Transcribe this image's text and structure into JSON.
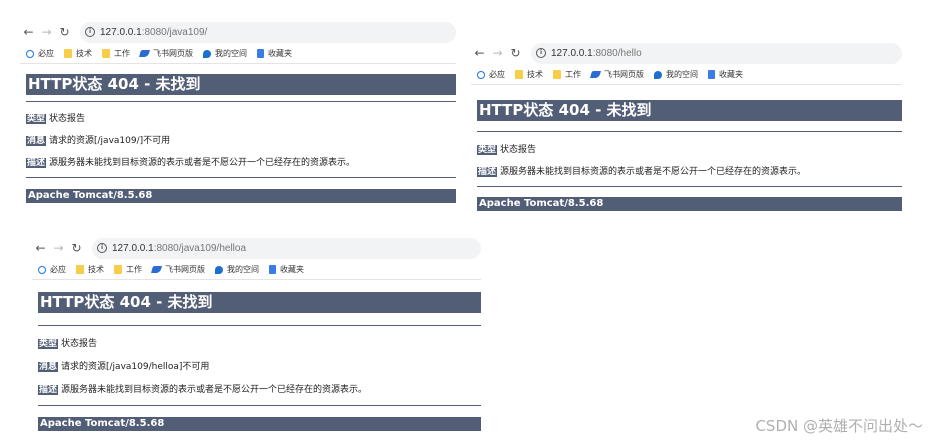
{
  "browser": {
    "bookmarks": [
      "必应",
      "技术",
      "工作",
      "飞书网页版",
      "我的空间",
      "收藏夹"
    ]
  },
  "panels": [
    {
      "url_host": "127.0.0.1",
      "url_path": ":8080/java109/",
      "title": "HTTP状态 404 - 未找到",
      "type_label": "类型",
      "type_value": "状态报告",
      "message_label": "消息",
      "message_value": "请求的资源[/java109/]不可用",
      "desc_label": "描述",
      "desc_value": "源服务器未能找到目标资源的表示或者是不愿公开一个已经存在的资源表示。",
      "footer": "Apache Tomcat/8.5.68"
    },
    {
      "url_host": "127.0.0.1",
      "url_path": ":8080/hello",
      "title": "HTTP状态 404 - 未找到",
      "type_label": "类型",
      "type_value": "状态报告",
      "desc_label": "描述",
      "desc_value": "源服务器未能找到目标资源的表示或者是不愿公开一个已经存在的资源表示。",
      "footer": "Apache Tomcat/8.5.68"
    },
    {
      "url_host": "127.0.0.1",
      "url_path": ":8080/java109/helloa",
      "title": "HTTP状态 404 - 未找到",
      "type_label": "类型",
      "type_value": "状态报告",
      "message_label": "消息",
      "message_value": "请求的资源[/java109/helloa]不可用",
      "desc_label": "描述",
      "desc_value": "源服务器未能找到目标资源的表示或者是不愿公开一个已经存在的资源表示。",
      "footer": "Apache Tomcat/8.5.68"
    }
  ],
  "watermark": "CSDN @英雄不问出处～"
}
